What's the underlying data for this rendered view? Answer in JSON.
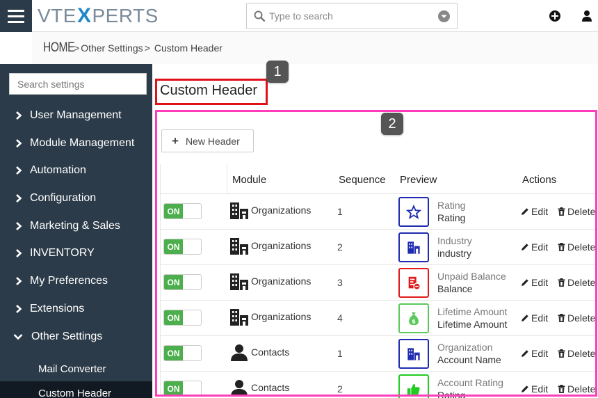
{
  "header": {
    "logo_prefix": "VTE",
    "logo_x": "X",
    "logo_suffix": "PERTS",
    "search_placeholder": "Type to search"
  },
  "breadcrumb": {
    "home": "HOME",
    "sep": ">",
    "parent": "Other Settings",
    "current": "Custom Header"
  },
  "sidebar": {
    "search_placeholder": "Search settings",
    "items": [
      {
        "label": "User Management"
      },
      {
        "label": "Module Management"
      },
      {
        "label": "Automation"
      },
      {
        "label": "Configuration"
      },
      {
        "label": "Marketing & Sales"
      },
      {
        "label": "INVENTORY"
      },
      {
        "label": "My Preferences"
      },
      {
        "label": "Extensions"
      },
      {
        "label": "Other Settings"
      }
    ],
    "subitems": [
      {
        "label": "Mail Converter"
      },
      {
        "label": "Custom Header"
      }
    ]
  },
  "main": {
    "title": "Custom Header",
    "new_button": "New Header",
    "badge1": "1",
    "badge2": "2",
    "columns": {
      "module": "Module",
      "sequence": "Sequence",
      "preview": "Preview",
      "actions": "Actions"
    },
    "toggle_label": "ON",
    "edit_label": "Edit",
    "delete_label": "Delete",
    "rows": [
      {
        "module": "Organizations",
        "module_icon": "building-icon",
        "sequence": "1",
        "preview_label": "Rating",
        "preview_value": "Rating",
        "preview_icon": "star-icon",
        "preview_color": "#1f2bb0"
      },
      {
        "module": "Organizations",
        "module_icon": "building-icon",
        "sequence": "2",
        "preview_label": "Industry",
        "preview_value": "industry",
        "preview_icon": "building-icon",
        "preview_color": "#1f2bb0"
      },
      {
        "module": "Organizations",
        "module_icon": "building-icon",
        "sequence": "3",
        "preview_label": "Unpaid Balance",
        "preview_value": "Balance",
        "preview_icon": "invoice-icon",
        "preview_color": "#e01a1a"
      },
      {
        "module": "Organizations",
        "module_icon": "building-icon",
        "sequence": "4",
        "preview_label": "Lifetime Amount",
        "preview_value": "Lifetime Amount",
        "preview_icon": "money-bag-icon",
        "preview_color": "#5cc85c"
      },
      {
        "module": "Contacts",
        "module_icon": "person-icon",
        "sequence": "1",
        "preview_label": "Organization",
        "preview_value": "Account Name",
        "preview_icon": "building-icon",
        "preview_color": "#1f2bb0"
      },
      {
        "module": "Contacts",
        "module_icon": "person-icon",
        "sequence": "2",
        "preview_label": "Account Rating",
        "preview_value": "Rating",
        "preview_icon": "thumbs-up-icon",
        "preview_color": "#22cc22"
      }
    ]
  },
  "colors": {
    "sidebar_bg": "#2c3b49",
    "toggle_on": "#4cae4c",
    "annotation_red": "#e0101a",
    "annotation_pink": "#ff3dbb",
    "logo_x": "#1e88c8"
  }
}
